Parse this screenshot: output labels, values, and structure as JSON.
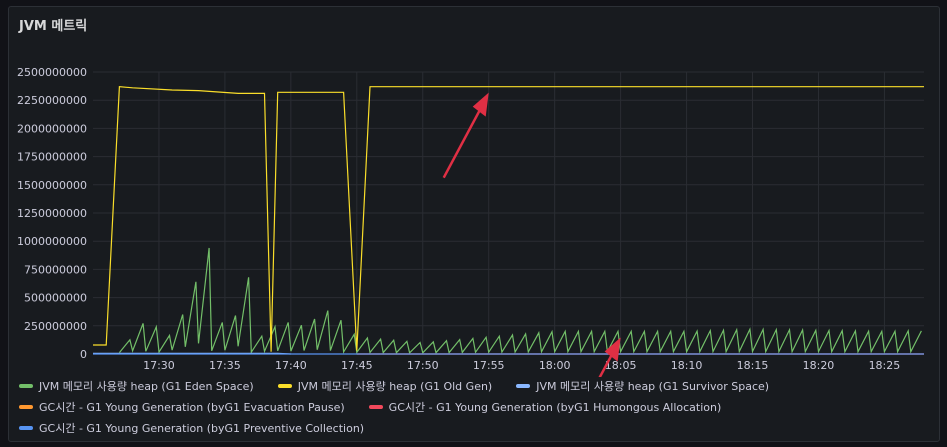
{
  "panel": {
    "title": "JVM 메트릭"
  },
  "chart_data": {
    "type": "line",
    "title": "JVM 메트릭",
    "ylim": [
      0,
      2500000000
    ],
    "yticks": [
      0,
      250000000,
      500000000,
      750000000,
      1000000000,
      1250000000,
      1500000000,
      1750000000,
      2000000000,
      2250000000,
      2500000000
    ],
    "xlim": [
      "17:25",
      "18:28"
    ],
    "xticks": [
      "17:30",
      "17:35",
      "17:40",
      "17:45",
      "17:50",
      "17:55",
      "18:00",
      "18:05",
      "18:10",
      "18:15",
      "18:20",
      "18:25"
    ],
    "grid": true,
    "legend_position": "bottom",
    "series": [
      {
        "name": "JVM 메모리 사용량 heap (G1 Eden Space)",
        "color": "#73bf69",
        "sawtooth": true,
        "x": [
          "17:27",
          "17:29",
          "17:31",
          "17:32",
          "17:33",
          "17:34",
          "17:35",
          "17:36",
          "17:37",
          "17:38",
          "17:39",
          "17:41",
          "17:43",
          "17:45",
          "17:50",
          "17:55",
          "18:00",
          "18:05",
          "18:10",
          "18:15",
          "18:20",
          "18:25",
          "18:27"
        ],
        "values": [
          10000000,
          300000000,
          150000000,
          400000000,
          700000000,
          1000000000,
          100000000,
          400000000,
          750000000,
          10000000,
          300000000,
          250000000,
          400000000,
          150000000,
          100000000,
          150000000,
          200000000,
          200000000,
          200000000,
          220000000,
          210000000,
          200000000,
          205000000
        ]
      },
      {
        "name": "JVM 메모리 사용량 heap (G1 Old Gen)",
        "color": "#fade2a",
        "x": [
          "17:25",
          "17:26",
          "17:27",
          "17:28",
          "17:31",
          "17:33",
          "17:36",
          "17:38",
          "17:38.5",
          "17:39",
          "17:40",
          "17:44",
          "17:45",
          "17:46",
          "18:28"
        ],
        "values": [
          80000000,
          80000000,
          2370000000,
          2360000000,
          2340000000,
          2335000000,
          2310000000,
          2310000000,
          20000000,
          2320000000,
          2320000000,
          2320000000,
          30000000,
          2370000000,
          2370000000
        ]
      },
      {
        "name": "JVM 메모리 사용량 heap (G1 Survivor Space)",
        "color": "#8ab8ff",
        "x": [
          "17:25",
          "17:39",
          "17:40"
        ],
        "values": [
          5000000,
          5000000,
          0
        ]
      },
      {
        "name": "GC시간 - G1 Young Generation (byG1 Evacuation Pause)",
        "color": "#ff9830",
        "x": [
          "17:45",
          "18:28"
        ],
        "values": [
          0,
          0
        ]
      },
      {
        "name": "GC시간 - G1 Young Generation (byG1 Humongous Allocation)",
        "color": "#f2495c",
        "x": [
          "17:45",
          "18:28"
        ],
        "values": [
          0,
          0
        ]
      },
      {
        "name": "GC시간 - G1 Young Generation (byG1 Preventive Collection)",
        "color": "#5794f2",
        "x": [
          "17:25",
          "18:28"
        ],
        "values": [
          0,
          0
        ]
      }
    ],
    "annotations": [
      {
        "type": "arrow",
        "color": "#e02f44",
        "points_to": {
          "x": "17:55",
          "series": "JVM 메모리 사용량 heap (G1 Old Gen)"
        }
      },
      {
        "type": "arrow",
        "color": "#e02f44",
        "points_to": {
          "x": "18:05",
          "series": "JVM 메모리 사용량 heap (G1 Eden Space)"
        }
      }
    ]
  }
}
